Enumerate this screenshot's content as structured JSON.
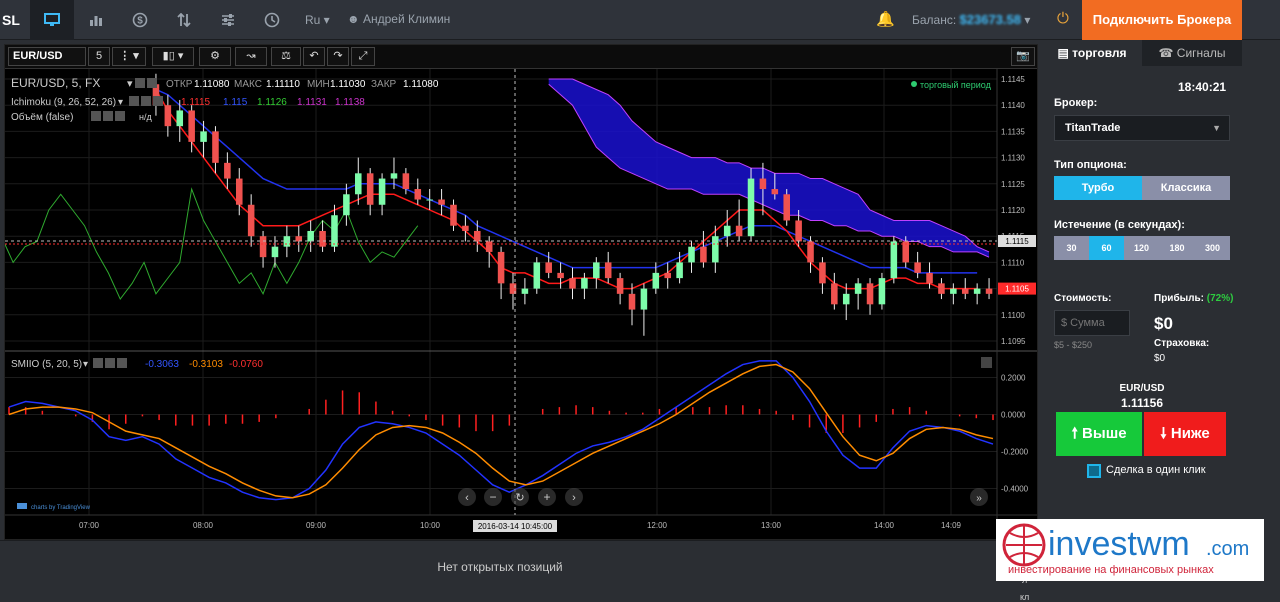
{
  "topbar": {
    "brand": "SL",
    "lang": "Ru ▾",
    "user": "Андрей Климин",
    "balance_label": "Баланс:",
    "balance_value": "$23673.58",
    "connect_label": "Подключить Брокера"
  },
  "toolbar": {
    "symbol": "EUR/USD",
    "interval": "5"
  },
  "chart_header": {
    "title": "EUR/USD, 5, FX",
    "open_label": "ОТКР",
    "open_value": "1.11080",
    "high_label": "МАКС",
    "high_value": "1.11110",
    "low_label": "МИН",
    "low_value": "1.11030",
    "close_label": "ЗАКР",
    "close_value": "1.11080",
    "trading_period": "торговый период",
    "ichimoku_label": "Ichimoku (9, 26, 52, 26)",
    "ichimoku_values": [
      "1.1115",
      "1.115",
      "1.1126",
      "1.1131",
      "1.1138"
    ],
    "volume_label": "Объём (false)",
    "volume_extra": "н/д",
    "smiio_label": "SMIIO (5, 20, 5)",
    "smiio_values": [
      "-0.3063",
      "-0.3103",
      "-0.0760"
    ],
    "tv_credit": "charts by TradingView"
  },
  "chart_data": [
    {
      "type": "candlestick",
      "title": "EUR/USD, 5, FX",
      "ylim": [
        1.1095,
        1.1145
      ],
      "yticks": [
        "1.1145",
        "1.1140",
        "1.1135",
        "1.1130",
        "1.1125",
        "1.1120",
        "1.1115",
        "1.1110",
        "1.1105",
        "1.1100",
        "1.1095"
      ],
      "last_price_label": "1.1105",
      "crosshair_price_label": "1.1115",
      "xticks": [
        "07:00",
        "08:00",
        "09:00",
        "10:00",
        "12:00",
        "13:00",
        "14:00",
        "14:09"
      ],
      "crosshair_time_label": "2016-03-14 10:45:00",
      "candles": [
        [
          1.1144,
          1.1146,
          1.1138,
          1.114
        ],
        [
          1.114,
          1.1142,
          1.1134,
          1.1136
        ],
        [
          1.1136,
          1.1141,
          1.1133,
          1.1139
        ],
        [
          1.1139,
          1.114,
          1.1131,
          1.1133
        ],
        [
          1.1133,
          1.1137,
          1.113,
          1.1135
        ],
        [
          1.1135,
          1.1136,
          1.1127,
          1.1129
        ],
        [
          1.1129,
          1.1131,
          1.1124,
          1.1126
        ],
        [
          1.1126,
          1.1128,
          1.1119,
          1.1121
        ],
        [
          1.1121,
          1.1123,
          1.1113,
          1.1115
        ],
        [
          1.1115,
          1.1116,
          1.1109,
          1.1111
        ],
        [
          1.1111,
          1.1115,
          1.1109,
          1.1113
        ],
        [
          1.1113,
          1.1117,
          1.1111,
          1.1115
        ],
        [
          1.1115,
          1.1117,
          1.1112,
          1.1114
        ],
        [
          1.1114,
          1.1118,
          1.1112,
          1.1116
        ],
        [
          1.1116,
          1.1118,
          1.1112,
          1.1113
        ],
        [
          1.1113,
          1.1121,
          1.1112,
          1.1119
        ],
        [
          1.1119,
          1.1125,
          1.1117,
          1.1123
        ],
        [
          1.1123,
          1.113,
          1.1121,
          1.1127
        ],
        [
          1.1127,
          1.1128,
          1.1119,
          1.1121
        ],
        [
          1.1121,
          1.1127,
          1.1119,
          1.1126
        ],
        [
          1.1126,
          1.113,
          1.1124,
          1.1127
        ],
        [
          1.1127,
          1.1128,
          1.1123,
          1.1124
        ],
        [
          1.1124,
          1.1126,
          1.1121,
          1.1122
        ],
        [
          1.1122,
          1.1124,
          1.112,
          1.1122
        ],
        [
          1.1122,
          1.1124,
          1.1119,
          1.1121
        ],
        [
          1.1121,
          1.1122,
          1.1116,
          1.1117
        ],
        [
          1.1117,
          1.1119,
          1.1114,
          1.1116
        ],
        [
          1.1116,
          1.1118,
          1.1112,
          1.1114
        ],
        [
          1.1114,
          1.1115,
          1.1109,
          1.1112
        ],
        [
          1.1112,
          1.1113,
          1.1103,
          1.1106
        ],
        [
          1.1106,
          1.1108,
          1.1101,
          1.1104
        ],
        [
          1.1104,
          1.1107,
          1.1102,
          1.1105
        ],
        [
          1.1105,
          1.1111,
          1.1104,
          1.111
        ],
        [
          1.111,
          1.1112,
          1.1107,
          1.1108
        ],
        [
          1.1108,
          1.111,
          1.1105,
          1.1107
        ],
        [
          1.1107,
          1.1109,
          1.1103,
          1.1105
        ],
        [
          1.1105,
          1.1108,
          1.1103,
          1.1107
        ],
        [
          1.1107,
          1.1111,
          1.1105,
          1.111
        ],
        [
          1.111,
          1.1112,
          1.1106,
          1.1107
        ],
        [
          1.1107,
          1.1108,
          1.1102,
          1.1104
        ],
        [
          1.1104,
          1.1106,
          1.1098,
          1.1101
        ],
        [
          1.1101,
          1.1106,
          1.1096,
          1.1105
        ],
        [
          1.1105,
          1.111,
          1.1104,
          1.1108
        ],
        [
          1.1108,
          1.111,
          1.1105,
          1.1107
        ],
        [
          1.1107,
          1.1112,
          1.1106,
          1.111
        ],
        [
          1.111,
          1.1114,
          1.1108,
          1.1113
        ],
        [
          1.1113,
          1.1116,
          1.1109,
          1.111
        ],
        [
          1.111,
          1.1117,
          1.1108,
          1.1115
        ],
        [
          1.1115,
          1.112,
          1.1113,
          1.1117
        ],
        [
          1.1117,
          1.1122,
          1.1114,
          1.1115
        ],
        [
          1.1115,
          1.1128,
          1.1114,
          1.1126
        ],
        [
          1.1126,
          1.1129,
          1.1119,
          1.1124
        ],
        [
          1.1124,
          1.1127,
          1.1122,
          1.1123
        ],
        [
          1.1123,
          1.1124,
          1.1117,
          1.1118
        ],
        [
          1.1118,
          1.112,
          1.1113,
          1.1114
        ],
        [
          1.1114,
          1.1115,
          1.1108,
          1.111
        ],
        [
          1.111,
          1.1111,
          1.1104,
          1.1106
        ],
        [
          1.1106,
          1.1108,
          1.1101,
          1.1102
        ],
        [
          1.1102,
          1.1106,
          1.1099,
          1.1104
        ],
        [
          1.1104,
          1.1107,
          1.1101,
          1.1106
        ],
        [
          1.1106,
          1.1107,
          1.11,
          1.1102
        ],
        [
          1.1102,
          1.1108,
          1.1101,
          1.1107
        ],
        [
          1.1107,
          1.1115,
          1.1106,
          1.1114
        ],
        [
          1.1114,
          1.1115,
          1.1109,
          1.111
        ],
        [
          1.111,
          1.1112,
          1.1107,
          1.1108
        ],
        [
          1.1108,
          1.111,
          1.1105,
          1.1106
        ],
        [
          1.1106,
          1.1107,
          1.1103,
          1.1104
        ],
        [
          1.1104,
          1.1106,
          1.1102,
          1.1105
        ],
        [
          1.1105,
          1.1107,
          1.1103,
          1.1104
        ],
        [
          1.1104,
          1.1106,
          1.1102,
          1.1105
        ],
        [
          1.1105,
          1.1107,
          1.1103,
          1.1104
        ]
      ],
      "ichimoku": {
        "tenkan": [
          1.1143,
          1.1139,
          1.1136,
          1.1133,
          1.113,
          1.1127,
          1.1124,
          1.1121,
          1.1119,
          1.1117,
          1.1117,
          1.1117,
          1.1117,
          1.1118,
          1.1119,
          1.112,
          1.1121,
          1.1122,
          1.1123,
          1.1123,
          1.1123,
          1.1122,
          1.1121,
          1.112,
          1.1119,
          1.1118,
          1.1116,
          1.1114,
          1.1112,
          1.1109,
          1.1108,
          1.1108,
          1.1107,
          1.1106,
          1.1106,
          1.1107,
          1.1107,
          1.1107,
          1.1106,
          1.1105,
          1.1105,
          1.1106,
          1.1107,
          1.1108,
          1.111,
          1.1112,
          1.1114,
          1.1116,
          1.1118,
          1.112,
          1.112,
          1.112,
          1.1118,
          1.1116,
          1.1113,
          1.111,
          1.1108,
          1.1106,
          1.1105,
          1.1105,
          1.1105,
          1.1106,
          1.1107,
          1.1107,
          1.1106,
          1.1106,
          1.1105,
          1.1105,
          1.1105,
          1.1105
        ],
        "kijun": [
          1.1143,
          1.1142,
          1.114,
          1.1138,
          1.1136,
          1.1134,
          1.1132,
          1.113,
          1.1128,
          1.1126,
          1.1125,
          1.1124,
          1.1124,
          1.1124,
          1.1124,
          1.1124,
          1.1124,
          1.1125,
          1.1125,
          1.1125,
          1.1125,
          1.1124,
          1.1123,
          1.1122,
          1.1121,
          1.112,
          1.1119,
          1.1117,
          1.1116,
          1.1115,
          1.1114,
          1.1113,
          1.1112,
          1.1111,
          1.111,
          1.1109,
          1.1109,
          1.1109,
          1.1109,
          1.1109,
          1.1109,
          1.1109,
          1.1109,
          1.111,
          1.1111,
          1.1112,
          1.1113,
          1.1114,
          1.1115,
          1.1116,
          1.1117,
          1.1117,
          1.1117,
          1.1116,
          1.1115,
          1.1114,
          1.1113,
          1.1112,
          1.1111,
          1.111,
          1.1109,
          1.1109,
          1.1109,
          1.1109,
          1.1108,
          1.1108,
          1.1108,
          1.1108,
          1.1108,
          1.1108
        ],
        "chikou": [
          1.1126,
          1.1124,
          1.1118,
          1.112,
          1.1114,
          1.1112,
          1.1115,
          1.111,
          1.1113,
          1.1114,
          1.112,
          1.1123,
          1.112,
          1.1117,
          1.1112,
          1.1108,
          1.1103,
          1.1106,
          1.111,
          1.1104,
          1.1107,
          1.111,
          1.1124,
          1.1118,
          1.1114,
          1.111,
          1.1106,
          1.1108,
          1.1104,
          1.111,
          1.1106,
          1.111,
          1.1115,
          1.1118,
          1.1116,
          1.112,
          1.1114,
          1.111,
          1.1112,
          1.1111,
          1.1114,
          1.1117
        ],
        "cloud_start": 33,
        "span_a": [
          1.1144,
          1.1142,
          1.114,
          1.1136,
          1.1132,
          1.113,
          1.1128,
          1.1127,
          1.1126,
          1.1125,
          1.1124,
          1.1124,
          1.1124,
          1.1123,
          1.1123,
          1.1123,
          1.1123,
          1.1122,
          1.1121,
          1.112,
          1.1119,
          1.1119,
          1.1118,
          1.1118,
          1.1117,
          1.1117,
          1.1116,
          1.1116,
          1.1115,
          1.1115,
          1.1114,
          1.1114,
          1.1113,
          1.1113,
          1.1112,
          1.1112,
          1.1112,
          1.1111
        ],
        "span_b": [
          1.1145,
          1.1145,
          1.1145,
          1.1144,
          1.1143,
          1.1142,
          1.114,
          1.1137,
          1.1135,
          1.1133,
          1.1132,
          1.1131,
          1.113,
          1.113,
          1.113,
          1.1129,
          1.1129,
          1.1128,
          1.1128,
          1.1127,
          1.1127,
          1.1127,
          1.1126,
          1.1126,
          1.1125,
          1.1124,
          1.1123,
          1.112,
          1.1119,
          1.1118,
          1.1118,
          1.1118,
          1.1118,
          1.1117,
          1.1116,
          1.1115,
          1.1113,
          1.1112
        ]
      }
    },
    {
      "type": "line",
      "title": "SMIIO (5, 20, 5)",
      "ylim": [
        -0.5,
        0.3
      ],
      "yticks": [
        "0.2000",
        "0.0000",
        "-0.2000",
        "-0.4000"
      ],
      "series": [
        {
          "name": "SMIIO",
          "color": "#2233ff",
          "values": [
            0.04,
            0.07,
            0.06,
            0.04,
            0.02,
            -0.03,
            -0.12,
            -0.14,
            -0.12,
            -0.16,
            -0.24,
            -0.29,
            -0.34,
            -0.37,
            -0.42,
            -0.45,
            -0.46,
            -0.45,
            -0.4,
            -0.3,
            -0.16,
            -0.07,
            -0.04,
            -0.05,
            -0.07,
            -0.1,
            -0.16,
            -0.22,
            -0.3,
            -0.38,
            -0.42,
            -0.38,
            -0.33,
            -0.27,
            -0.21,
            -0.17,
            -0.15,
            -0.12,
            -0.08,
            -0.02,
            0.04,
            0.1,
            0.16,
            0.22,
            0.27,
            0.29,
            0.29,
            0.2,
            0.07,
            -0.09,
            -0.22,
            -0.29,
            -0.29,
            -0.18,
            -0.09,
            -0.06,
            -0.07,
            -0.09,
            -0.13,
            -0.16
          ]
        },
        {
          "name": "Signal",
          "color": "#ff8c00",
          "values": [
            0.0,
            0.03,
            0.04,
            0.04,
            0.03,
            0.01,
            -0.04,
            -0.09,
            -0.11,
            -0.13,
            -0.18,
            -0.23,
            -0.28,
            -0.32,
            -0.37,
            -0.41,
            -0.44,
            -0.45,
            -0.43,
            -0.38,
            -0.29,
            -0.19,
            -0.11,
            -0.07,
            -0.06,
            -0.07,
            -0.1,
            -0.15,
            -0.21,
            -0.29,
            -0.36,
            -0.38,
            -0.36,
            -0.31,
            -0.26,
            -0.21,
            -0.17,
            -0.13,
            -0.09,
            -0.05,
            0.0,
            0.06,
            0.12,
            0.17,
            0.22,
            0.26,
            0.27,
            0.23,
            0.14,
            0.01,
            -0.12,
            -0.22,
            -0.25,
            -0.21,
            -0.13,
            -0.08,
            -0.07,
            -0.08,
            -0.11,
            -0.13
          ]
        },
        {
          "name": "Histogram",
          "color": "#ff2020",
          "values": [
            0.04,
            0.04,
            0.02,
            0.0,
            -0.01,
            -0.04,
            -0.08,
            -0.05,
            -0.01,
            -0.03,
            -0.06,
            -0.06,
            -0.06,
            -0.05,
            -0.05,
            -0.04,
            -0.02,
            0.0,
            0.03,
            0.08,
            0.13,
            0.12,
            0.07,
            0.02,
            -0.01,
            -0.03,
            -0.06,
            -0.07,
            -0.09,
            -0.09,
            -0.06,
            0.0,
            0.03,
            0.04,
            0.05,
            0.04,
            0.02,
            0.01,
            0.01,
            0.03,
            0.04,
            0.04,
            0.04,
            0.05,
            0.05,
            0.03,
            0.02,
            -0.03,
            -0.07,
            -0.1,
            -0.1,
            -0.07,
            -0.04,
            0.03,
            0.04,
            0.02,
            0.0,
            -0.01,
            -0.02,
            -0.03
          ]
        }
      ]
    }
  ],
  "right_panel": {
    "tab_trade": "торговля",
    "tab_signals": "Сигналы",
    "time": "18:40:21",
    "broker_label": "Брокер:",
    "broker_value": "TitanTrade",
    "option_type_label": "Тип опциона:",
    "option_turbo": "Турбо",
    "option_classic": "Классика",
    "expiry_label": "Истечение (в секундах):",
    "expiry_options": [
      "30",
      "60",
      "120",
      "180",
      "300"
    ],
    "cost_label": "Стоимость:",
    "cost_placeholder": "$ Сумма",
    "cost_range": "$5 - $250",
    "profit_label": "Прибыль:",
    "profit_pct": "(72%)",
    "profit_value": "$0",
    "insurance_label": "Страховка:",
    "insurance_value": "$0",
    "pair": "EUR/USD",
    "price": "1.11156",
    "up_label": "Выше",
    "down_label": "Ниже",
    "one_click": "Сделка в один клик",
    "accent": "#1fb5ea",
    "up_color": "#16c93a",
    "down_color": "#f01c1c"
  },
  "bottom": {
    "no_positions": "Нет открытых позиций",
    "partial_1": "л",
    "partial_2": "кл"
  },
  "logo": {
    "main": "investwm",
    "suffix": ".com",
    "tagline": "инвестирование на финансовых рынках"
  }
}
